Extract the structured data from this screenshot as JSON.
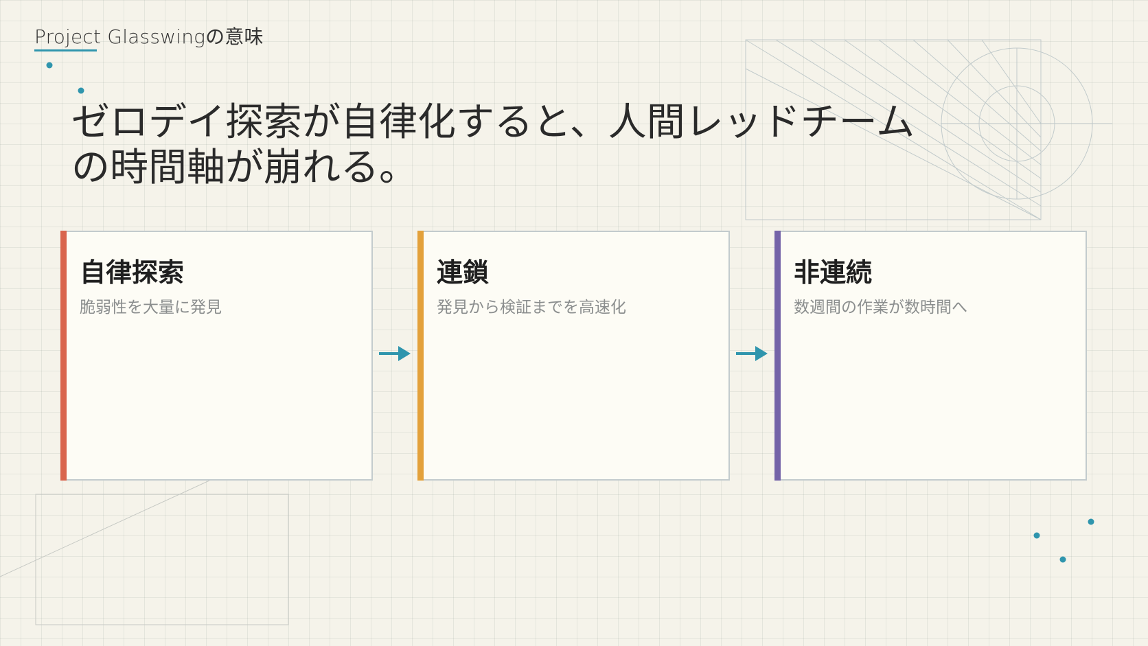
{
  "header": {
    "kicker": "Project Glasswingの意味"
  },
  "headline": {
    "line1": "ゼロデイ探索が自律化すると、人間レッドチーム",
    "line2": "の時間軸が崩れる。"
  },
  "cards": [
    {
      "title": "自律探索",
      "description": "脆弱性を大量に発見",
      "accent": "#d9654d"
    },
    {
      "title": "連鎖",
      "description": "発見から検証までを高速化",
      "accent": "#e3a13b"
    },
    {
      "title": "非連続",
      "description": "数週間の作業が数時間へ",
      "accent": "#7463a8"
    }
  ],
  "colors": {
    "background": "#f5f3ea",
    "accent": "#2f95ad",
    "card_border": "#c3cbcd"
  },
  "icons": {
    "flow_arrow": "right-arrow-icon"
  }
}
